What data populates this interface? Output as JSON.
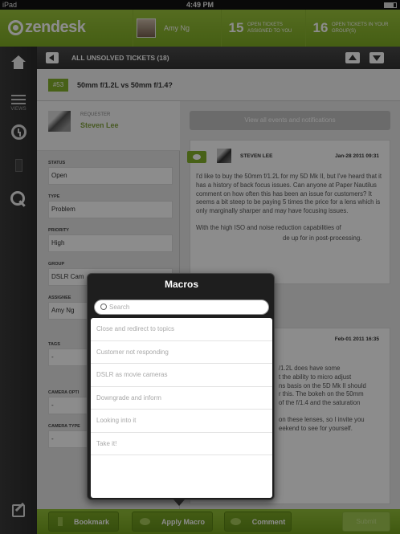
{
  "status_bar": {
    "carrier": "iPad",
    "time": "4:49 PM"
  },
  "header": {
    "logo": "zendesk",
    "user_name": "Amy Ng",
    "stats": [
      {
        "count": "15",
        "label": "Open tickets assigned to you"
      },
      {
        "count": "16",
        "label": "Open tickets in your group(s)"
      }
    ]
  },
  "nav": {
    "views_label": "VIEWS"
  },
  "titlebar": {
    "title": "ALL UNSOLVED TICKETS (18)"
  },
  "ticket": {
    "id": "#53",
    "subject": "50mm f/1.2L vs 50mm f/1.4?"
  },
  "requester": {
    "label": "REQUESTER",
    "name": "Steven Lee"
  },
  "fields": [
    {
      "label": "STATUS",
      "value": "Open"
    },
    {
      "label": "TYPE",
      "value": "Problem"
    },
    {
      "label": "PRIORITY",
      "value": "High"
    },
    {
      "label": "GROUP",
      "value": "DSLR Cam"
    },
    {
      "label": "ASSIGNEE",
      "value": "Amy Ng"
    },
    {
      "label": "TAGS",
      "value": "-"
    },
    {
      "label": "CAMERA OPTI",
      "value": "-"
    },
    {
      "label": "CAMERA TYPE",
      "value": "-"
    }
  ],
  "events": {
    "view_all_label": "View all events and notifications",
    "items": [
      {
        "author": "STEVEN LEE",
        "date": "Jan-28 2011 09:31",
        "body_lines": [
          "I'd like to buy the 50mm f/1.2L for my 5D Mk II, but I've heard that it has",
          "a history of back focus issues.  Can anyone at Paper Nautilus comment on how",
          "often this has been an issue for customers?  It seems a bit steep to be",
          "paying 5 times the price for a lens which is only marginally sharper and may",
          "have focusing issues."
        ],
        "body2": "With the high ISO and noise reduction capabilities of",
        "body3": "de up for in post-processing."
      },
      {
        "date": "Feb-01 2011 16:35",
        "lines": [
          "/1.2L does have some",
          "t the ability to micro adjust",
          "ns basis on the 5D Mk II should",
          "r this.  The bokeh on the 50mm",
          "of the f/1.4 and the saturation",
          "",
          "on these lenses, so I invite you",
          "eekend to see for yourself."
        ]
      }
    ]
  },
  "macros": {
    "title": "Macros",
    "search_placeholder": "Search",
    "items": [
      "Close and redirect to topics",
      "Customer not responding",
      "DSLR as movie cameras",
      "Downgrade and inform",
      "Looking into it",
      "Take it!"
    ]
  },
  "actions": {
    "bookmark": "Bookmark",
    "apply_macro": "Apply Macro",
    "comment": "Comment",
    "submit": "Submit"
  }
}
